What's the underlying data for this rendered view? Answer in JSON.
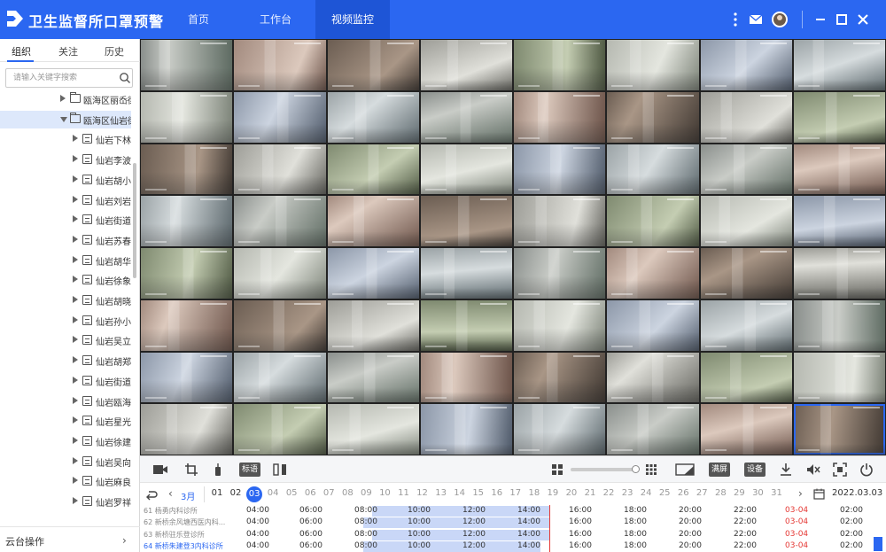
{
  "app": {
    "title": "卫生监督所口罩预警",
    "logo": "logo-icon"
  },
  "nav": [
    {
      "label": "首页"
    },
    {
      "label": "工作台"
    },
    {
      "label": "视频监控"
    }
  ],
  "topbar_icons": [
    "more-icon",
    "mail-icon",
    "avatar",
    "minimize-icon",
    "maximize-icon",
    "close-icon"
  ],
  "sidebar": {
    "tabs": [
      {
        "label": "组织"
      },
      {
        "label": "关注"
      },
      {
        "label": "历史"
      }
    ],
    "search_placeholder": "请输入关键字搜索",
    "tree": [
      {
        "type": "folder",
        "label": "瓯海区丽岙街"
      },
      {
        "type": "folder",
        "label": "瓯海区仙岩街"
      },
      {
        "type": "cam",
        "label": "仙岩下林"
      },
      {
        "type": "cam",
        "label": "仙岩李波"
      },
      {
        "type": "cam",
        "label": "仙岩胡小"
      },
      {
        "type": "cam",
        "label": "仙岩刘岩"
      },
      {
        "type": "cam",
        "label": "仙岩街道"
      },
      {
        "type": "cam",
        "label": "仙岩苏春"
      },
      {
        "type": "cam",
        "label": "仙岩胡华"
      },
      {
        "type": "cam",
        "label": "仙岩徐象"
      },
      {
        "type": "cam",
        "label": "仙岩胡晓"
      },
      {
        "type": "cam",
        "label": "仙岩孙小"
      },
      {
        "type": "cam",
        "label": "仙岩吴立"
      },
      {
        "type": "cam",
        "label": "仙岩胡郑"
      },
      {
        "type": "cam",
        "label": "仙岩街道"
      },
      {
        "type": "cam",
        "label": "仙岩瓯海"
      },
      {
        "type": "cam",
        "label": "仙岩星光"
      },
      {
        "type": "cam",
        "label": "仙岩徐建"
      },
      {
        "type": "cam",
        "label": "仙岩吴向"
      },
      {
        "type": "cam",
        "label": "仙岩麻良"
      },
      {
        "type": "cam",
        "label": "仙岩罗祥"
      }
    ],
    "bottom_label": "云台操作"
  },
  "toolbar": {
    "tag_label": "标语",
    "fullscreen_label": "满屏",
    "device_label": "设备"
  },
  "datebar": {
    "month": "3月",
    "days": [
      "01",
      "02",
      "03",
      "04",
      "05",
      "06",
      "07",
      "08",
      "09",
      "10",
      "11",
      "12",
      "13",
      "14",
      "15",
      "16",
      "17",
      "18",
      "19",
      "20",
      "21",
      "22",
      "23",
      "24",
      "25",
      "26",
      "27",
      "28",
      "29",
      "30",
      "31"
    ],
    "current_day": "03",
    "date": "2022.03.03"
  },
  "timeline": {
    "rows": [
      {
        "name": "61 杨勇内科诊所",
        "active": false
      },
      {
        "name": "62 新桥余风塘西医内科...",
        "active": false
      },
      {
        "name": "63 新桥驻乐登诊所",
        "active": false
      },
      {
        "name": "64 新桥朱建登3内科诊所",
        "active": true
      }
    ],
    "times": [
      "04:00",
      "06:00",
      "08:00",
      "10:00",
      "12:00",
      "14:00",
      "16:00",
      "18:00",
      "20:00",
      "22:00",
      "03-04",
      "02:00"
    ]
  }
}
